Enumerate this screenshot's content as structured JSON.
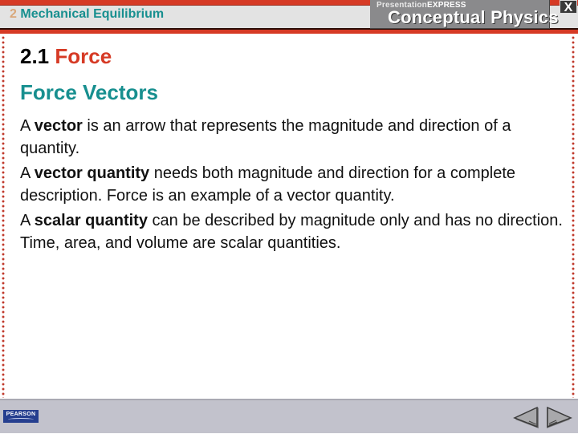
{
  "header": {
    "chapter_number": "2",
    "chapter_title": "Mechanical Equilibrium",
    "brand_small_prefix": "Presentation",
    "brand_small_suffix": "EXPRESS",
    "brand_title": "Conceptual Physics",
    "close_label": "X"
  },
  "slide": {
    "section_number": "2.1",
    "section_name": "Force",
    "heading": "Force Vectors",
    "paragraphs": [
      {
        "pre": "A ",
        "bold": "vector",
        "post": " is an arrow that represents the magnitude and direction of a quantity."
      },
      {
        "pre": "A ",
        "bold": "vector quantity",
        "post": " needs both magnitude and direction for a complete description. Force is an example of a vector quantity."
      },
      {
        "pre": "A ",
        "bold": "scalar quantity",
        "post": " can be described by magnitude only and has no direction. Time, area, and volume are scalar quantities."
      }
    ]
  },
  "footer": {
    "publisher_logo": "PEARSON",
    "prev_icon": "triangle-left-icon",
    "next_icon": "triangle-right-icon"
  },
  "colors": {
    "accent_red": "#d63a25",
    "teal": "#178f8f",
    "chapter_number": "#d9a77a",
    "footer_bg": "#c2c2cc",
    "brand_bg": "#8a8a8c"
  }
}
